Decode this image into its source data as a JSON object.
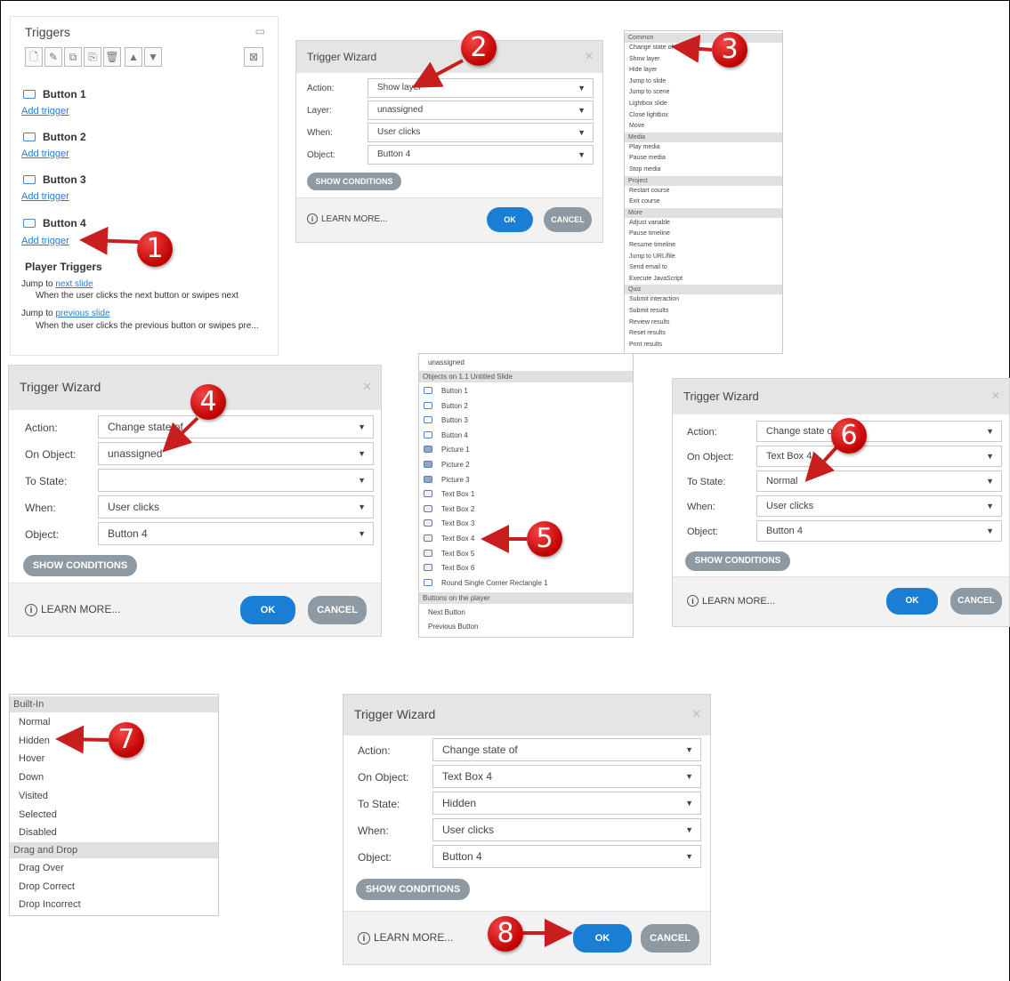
{
  "triggers_panel": {
    "title": "Triggers",
    "buttons": [
      {
        "label": "Button 1",
        "link": "Add trigger"
      },
      {
        "label": "Button 2",
        "link": "Add trigger"
      },
      {
        "label": "Button 3",
        "link": "Add trigger"
      },
      {
        "label": "Button 4",
        "link": "Add trigger"
      }
    ],
    "player_triggers_title": "Player Triggers",
    "player_triggers": [
      {
        "prefix": "Jump to ",
        "link": "next slide",
        "desc": "When the user clicks the next button or swipes next"
      },
      {
        "prefix": "Jump to ",
        "link": "previous slide",
        "desc": "When the user clicks the previous button or swipes pre..."
      }
    ]
  },
  "wizard_common": {
    "title": "Trigger Wizard",
    "show_conditions": "SHOW CONDITIONS",
    "learn_more": "LEARN MORE...",
    "ok": "OK",
    "cancel": "CANCEL"
  },
  "wizard_2": {
    "fields": [
      {
        "label": "Action:",
        "value": "Show layer"
      },
      {
        "label": "Layer:",
        "value": "unassigned"
      },
      {
        "label": "When:",
        "value": "User clicks"
      },
      {
        "label": "Object:",
        "value": "Button 4"
      }
    ]
  },
  "wizard_4": {
    "fields": [
      {
        "label": "Action:",
        "value": "Change state of"
      },
      {
        "label": "On Object:",
        "value": "unassigned"
      },
      {
        "label": "To State:",
        "value": ""
      },
      {
        "label": "When:",
        "value": "User clicks"
      },
      {
        "label": "Object:",
        "value": "Button 4"
      }
    ]
  },
  "wizard_6": {
    "fields": [
      {
        "label": "Action:",
        "value": "Change state of"
      },
      {
        "label": "On Object:",
        "value": "Text Box 4"
      },
      {
        "label": "To State:",
        "value": "Normal"
      },
      {
        "label": "When:",
        "value": "User clicks"
      },
      {
        "label": "Object:",
        "value": "Button 4"
      }
    ]
  },
  "wizard_8": {
    "fields": [
      {
        "label": "Action:",
        "value": "Change state of"
      },
      {
        "label": "On Object:",
        "value": "Text Box 4"
      },
      {
        "label": "To State:",
        "value": "Hidden"
      },
      {
        "label": "When:",
        "value": "User clicks"
      },
      {
        "label": "Object:",
        "value": "Button 4"
      }
    ]
  },
  "action_list": {
    "groups": [
      {
        "header": "Common",
        "items": [
          "Change state of",
          "Show layer",
          "Hide layer",
          "Jump to slide",
          "Jump to scene",
          "Lightbox slide",
          "Close lightbox",
          "Move"
        ]
      },
      {
        "header": "Media",
        "items": [
          "Play media",
          "Pause media",
          "Stop media"
        ]
      },
      {
        "header": "Project",
        "items": [
          "Restart course",
          "Exit course"
        ]
      },
      {
        "header": "More",
        "items": [
          "Adjust variable",
          "Pause timeline",
          "Resume timeline",
          "Jump to URL/file",
          "Send email to",
          "Execute JavaScript"
        ]
      },
      {
        "header": "Quiz",
        "items": [
          "Submit interaction",
          "Submit results",
          "Review results",
          "Reset results",
          "Print results"
        ]
      }
    ]
  },
  "object_list": {
    "top_item": "unassigned",
    "slide_header": "Objects on 1.1 Untitled Slide",
    "objects": [
      {
        "label": "Button 1",
        "icon": "button-icon"
      },
      {
        "label": "Button 2",
        "icon": "button-icon"
      },
      {
        "label": "Button 3",
        "icon": "button-icon"
      },
      {
        "label": "Button 4",
        "icon": "button-icon"
      },
      {
        "label": "Picture 1",
        "icon": "picture-icon"
      },
      {
        "label": "Picture 2",
        "icon": "picture-icon"
      },
      {
        "label": "Picture 3",
        "icon": "picture-icon"
      },
      {
        "label": "Text Box 1",
        "icon": "textbox-icon"
      },
      {
        "label": "Text Box 2",
        "icon": "textbox-icon"
      },
      {
        "label": "Text Box 3",
        "icon": "textbox-icon"
      },
      {
        "label": "Text Box 4",
        "icon": "textbox-icon"
      },
      {
        "label": "Text Box 5",
        "icon": "textbox-icon"
      },
      {
        "label": "Text Box 6",
        "icon": "textbox-icon"
      },
      {
        "label": "Round Single Corner Rectangle 1",
        "icon": "button-icon"
      }
    ],
    "player_header": "Buttons on the player",
    "player_items": [
      "Next Button",
      "Previous Button"
    ]
  },
  "state_list": {
    "groups": [
      {
        "header": "Built-In",
        "items": [
          "Normal",
          "Hidden",
          "Hover",
          "Down",
          "Visited",
          "Selected",
          "Disabled"
        ]
      },
      {
        "header": "Drag and Drop",
        "items": [
          "Drag Over",
          "Drop Correct",
          "Drop Incorrect"
        ]
      }
    ]
  },
  "callouts": [
    "1",
    "2",
    "3",
    "4",
    "5",
    "6",
    "7",
    "8"
  ],
  "colors": {
    "callout_red": "#d81f1f",
    "ok_blue": "#1a7fd4",
    "neutral_button": "#8e9aa3",
    "link_blue": "#2a7ad6",
    "header_gray": "#e5e5e5"
  }
}
